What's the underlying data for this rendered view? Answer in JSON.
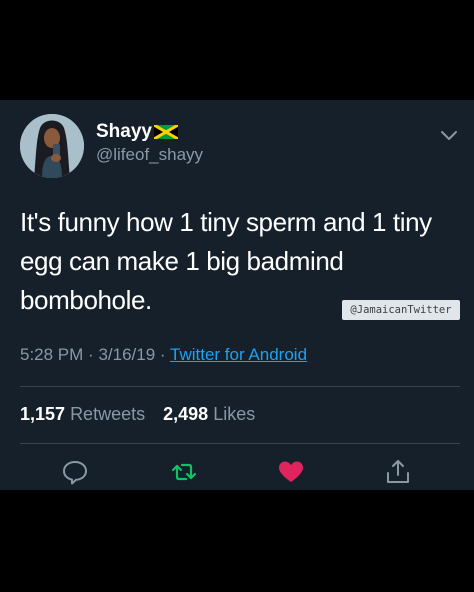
{
  "tweet": {
    "display_name": "Shayy",
    "handle": "@lifeof_shayy",
    "text": "It's funny how 1 tiny sperm and 1 tiny\negg can make 1 big badmind\nbombohole.",
    "time": "5:28 PM",
    "date": "3/16/19",
    "separator": "·",
    "source": "Twitter for Android",
    "retweets_count": "1,157",
    "retweets_label": "Retweets",
    "likes_count": "2,498",
    "likes_label": "Likes"
  },
  "watermark": "@JamaicanTwitter",
  "icons": {
    "flag": "jamaica-flag-icon",
    "caret": "chevron-down-icon",
    "reply": "reply-icon",
    "retweet": "retweet-icon",
    "like": "heart-icon",
    "share": "share-icon"
  },
  "colors": {
    "background": "#15202b",
    "text": "#ffffff",
    "secondary": "#8899a6",
    "link": "#1da1f2",
    "retweet": "#17bf63",
    "like": "#e0245e",
    "divider": "#38444d"
  }
}
